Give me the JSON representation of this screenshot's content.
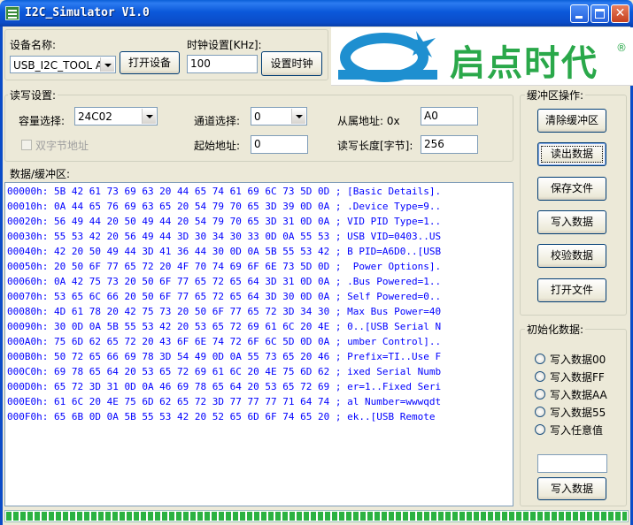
{
  "window": {
    "title": "I2C_Simulator V1.0"
  },
  "device": {
    "name_label": "设备名称:",
    "name_value": "USB_I2C_TOOL A",
    "open_button": "打开设备",
    "clock_label": "时钟设置[KHz]:",
    "clock_value": "100",
    "set_clock_button": "设置时钟"
  },
  "logo": {
    "text": "启点时代",
    "registered": "®",
    "color": "#2AA84A"
  },
  "rw": {
    "group_title": "读写设置:",
    "capacity_label": "容量选择:",
    "capacity_value": "24C02",
    "channel_label": "通道选择:",
    "channel_value": "0",
    "slave_label": "从属地址: 0x",
    "slave_value": "A0",
    "dual_byte_label": "双字节地址",
    "start_label": "起始地址:",
    "start_value": "0",
    "length_label": "读写长度[字节]:",
    "length_value": "256"
  },
  "buffer": {
    "group_title": "数据/缓冲区:",
    "lines": [
      "00000h: 5B 42 61 73 69 63 20 44 65 74 61 69 6C 73 5D 0D ; [Basic Details].",
      "00010h: 0A 44 65 76 69 63 65 20 54 79 70 65 3D 39 0D 0A ; .Device Type=9..",
      "00020h: 56 49 44 20 50 49 44 20 54 79 70 65 3D 31 0D 0A ; VID PID Type=1..",
      "00030h: 55 53 42 20 56 49 44 3D 30 34 30 33 0D 0A 55 53 ; USB VID=0403..US",
      "00040h: 42 20 50 49 44 3D 41 36 44 30 0D 0A 5B 55 53 42 ; B PID=A6D0..[USB",
      "00050h: 20 50 6F 77 65 72 20 4F 70 74 69 6F 6E 73 5D 0D ;  Power Options].",
      "00060h: 0A 42 75 73 20 50 6F 77 65 72 65 64 3D 31 0D 0A ; .Bus Powered=1..",
      "00070h: 53 65 6C 66 20 50 6F 77 65 72 65 64 3D 30 0D 0A ; Self Powered=0..",
      "00080h: 4D 61 78 20 42 75 73 20 50 6F 77 65 72 3D 34 30 ; Max Bus Power=40",
      "00090h: 30 0D 0A 5B 55 53 42 20 53 65 72 69 61 6C 20 4E ; 0..[USB Serial N",
      "000A0h: 75 6D 62 65 72 20 43 6F 6E 74 72 6F 6C 5D 0D 0A ; umber Control]..",
      "000B0h: 50 72 65 66 69 78 3D 54 49 0D 0A 55 73 65 20 46 ; Prefix=TI..Use F",
      "000C0h: 69 78 65 64 20 53 65 72 69 61 6C 20 4E 75 6D 62 ; ixed Serial Numb",
      "000D0h: 65 72 3D 31 0D 0A 46 69 78 65 64 20 53 65 72 69 ; er=1..Fixed Seri",
      "000E0h: 61 6C 20 4E 75 6D 62 65 72 3D 77 77 77 71 64 74 ; al Number=wwwqdt",
      "000F0h: 65 6B 0D 0A 5B 55 53 42 20 52 65 6D 6F 74 65 20 ; ek..[USB Remote "
    ],
    "text_color": "#0000FF"
  },
  "buffer_ops": {
    "group_title": "缓冲区操作:",
    "clear": "清除缓冲区",
    "read": "读出数据",
    "save": "保存文件",
    "write": "写入数据",
    "verify": "校验数据",
    "open_file": "打开文件"
  },
  "init": {
    "group_title": "初始化数据:",
    "options": [
      "写入数据00",
      "写入数据FF",
      "写入数据AA",
      "写入数据55",
      "写入任意值"
    ],
    "value": "",
    "write_button": "写入数据"
  },
  "progress": {
    "fraction": 1.0,
    "color": "#2BB241"
  }
}
